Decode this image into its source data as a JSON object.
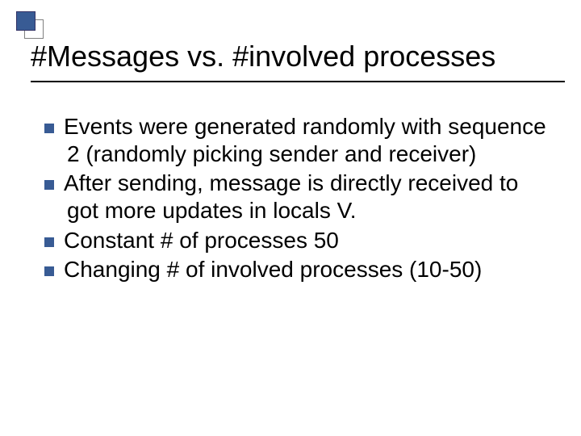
{
  "title": "#Messages vs. #involved processes",
  "bullets": [
    "Events were generated randomly with sequence 2 (randomly picking sender and receiver)",
    "After sending,  message is directly received to got more updates in locals V.",
    "Constant # of processes 50",
    "Changing # of involved processes (10-50)"
  ]
}
